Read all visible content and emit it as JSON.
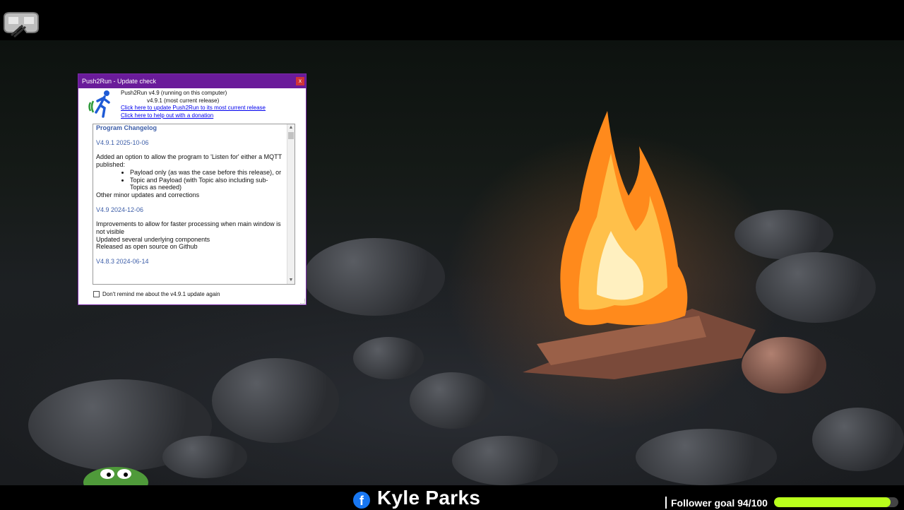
{
  "dialog": {
    "title": "Push2Run - Update check",
    "close_glyph": "x",
    "current_version_line": "Push2Run v4.9 (running on this computer)",
    "latest_version_line": "v4.9.1 (most current release)",
    "update_link": "Click here to update Push2Run to its most current release",
    "donate_link": "Click here to help out with a donation",
    "remind_label": "Don't remind me about the v4.9.1 update again",
    "remind_checked": false,
    "icon": "running-man-icon",
    "accent_color": "#6a1b9a"
  },
  "changelog": {
    "heading": "Program Changelog",
    "entries": [
      {
        "version": "V4.9.1 2025-10-06",
        "intro": "Added an option to allow the program to 'Listen for' either a MQTT published:",
        "bullets": [
          "Payload only (as was the case before this release), or",
          "Topic and Payload (with Topic also including sub-Topics as needed)"
        ],
        "lines": [
          "Other minor updates and corrections"
        ]
      },
      {
        "version": "V4.9 2024-12-06",
        "lines": [
          "Improvements to allow for faster processing when main window is not visible",
          "Updated several underlying components",
          "Released as open source on Github"
        ]
      },
      {
        "version": "V4.8.3 2024-06-14"
      }
    ]
  },
  "overlay": {
    "streamer_name": "Kyle Parks",
    "facebook_glyph": "f",
    "goal_label": "Follower goal 94/100",
    "goal_progress": 0.94,
    "goal_color": "#b9ff1c"
  }
}
